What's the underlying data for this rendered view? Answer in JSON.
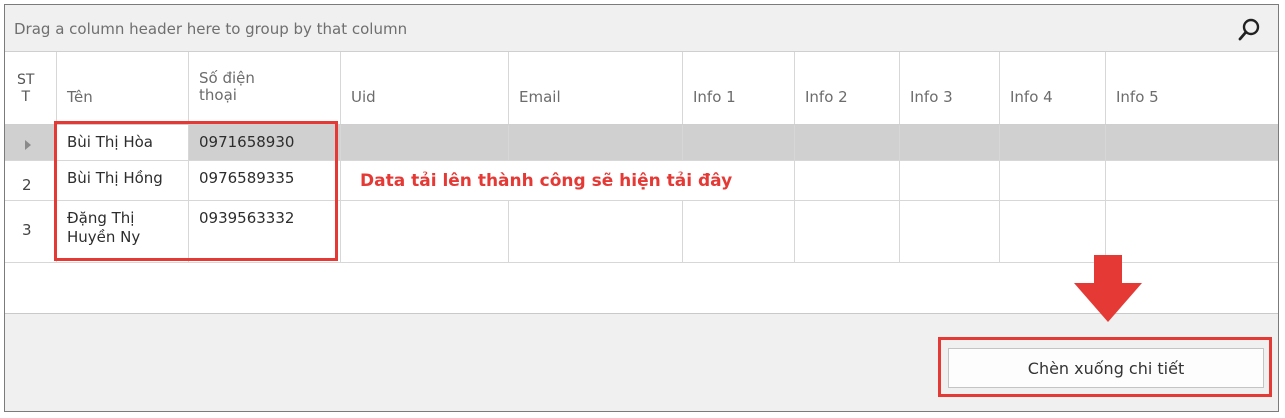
{
  "group_panel": {
    "hint": "Drag a column header here to group by that column",
    "search_icon": "search-icon"
  },
  "columns": [
    "ST T",
    "Tên",
    "Số điện thoại",
    "Uid",
    "Email",
    "Info 1",
    "Info 2",
    "Info 3",
    "Info 4",
    "Info 5"
  ],
  "header_lines": {
    "stt": [
      "ST",
      "T"
    ],
    "phone": [
      "Số điện",
      "thoại"
    ]
  },
  "rows": [
    {
      "indicator": "",
      "name_lines": [
        "Bùi Thị Hòa"
      ],
      "phone": "0971658930"
    },
    {
      "indicator": "2",
      "name_lines": [
        "Bùi Thị Hồng"
      ],
      "phone": "0976589335"
    },
    {
      "indicator": "3",
      "name_lines": [
        "Đặng Thị",
        "Huyền Ny"
      ],
      "phone": "0939563332"
    }
  ],
  "annotation": "Data tải lên thành công sẽ hiện tải đây",
  "button": {
    "label": "Chèn xuống chi tiết"
  },
  "colors": {
    "annotation_red": "#e53935",
    "selected_row": "#d0d0d0"
  }
}
